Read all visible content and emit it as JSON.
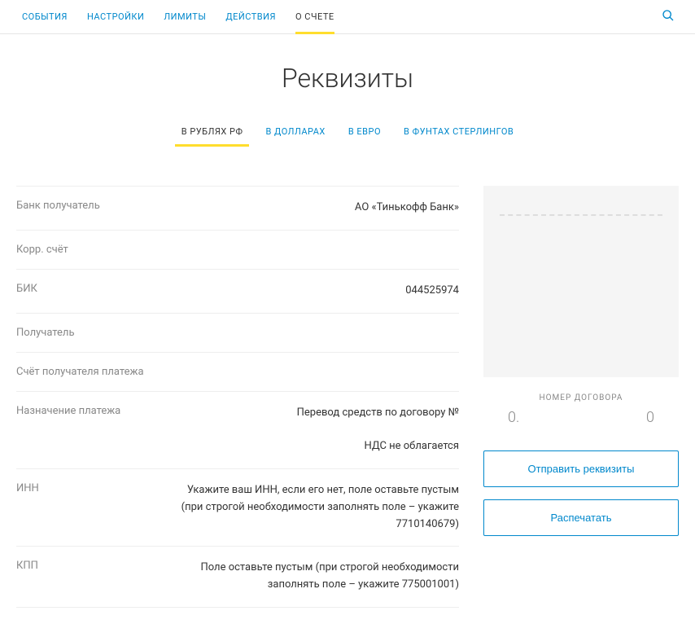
{
  "topNav": {
    "tabs": [
      {
        "label": "СОБЫТИЯ"
      },
      {
        "label": "НАСТРОЙКИ"
      },
      {
        "label": "ЛИМИТЫ"
      },
      {
        "label": "ДЕЙСТВИЯ"
      },
      {
        "label": "О СЧЕТЕ"
      }
    ]
  },
  "page": {
    "title": "Реквизиты"
  },
  "subNav": {
    "tabs": [
      {
        "label": "В РУБЛЯХ РФ"
      },
      {
        "label": "В ДОЛЛАРАХ"
      },
      {
        "label": "В ЕВРО"
      },
      {
        "label": "В ФУНТАХ СТЕРЛИНГОВ"
      }
    ]
  },
  "rows": {
    "bank": {
      "label": "Банк получатель",
      "value": "АО «Тинькофф Банк»"
    },
    "corr": {
      "label": "Корр. счёт",
      "value": ""
    },
    "bic": {
      "label": "БИК",
      "value": "044525974"
    },
    "recipient": {
      "label": "Получатель",
      "value": ""
    },
    "account": {
      "label": "Счёт получателя платежа",
      "value": ""
    },
    "purpose": {
      "label": "Назначение платежа",
      "value": "Перевод средств по договору №\n\nНДС не облагается"
    },
    "inn": {
      "label": "ИНН",
      "value": "Укажите ваш ИНН, если его нет, поле оставьте пустым (при строгой необходимости заполнять поле – укажите 7710140679)"
    },
    "kpp": {
      "label": "КПП",
      "value": "Поле оставьте пустым (при строгой необходимости заполнять поле – укажите 775001001)"
    }
  },
  "sidebar": {
    "contractLabel": "НОМЕР ДОГОВОРА",
    "contractLeft": "0.",
    "contractRight": "0",
    "sendButton": "Отправить реквизиты",
    "printButton": "Распечатать"
  }
}
